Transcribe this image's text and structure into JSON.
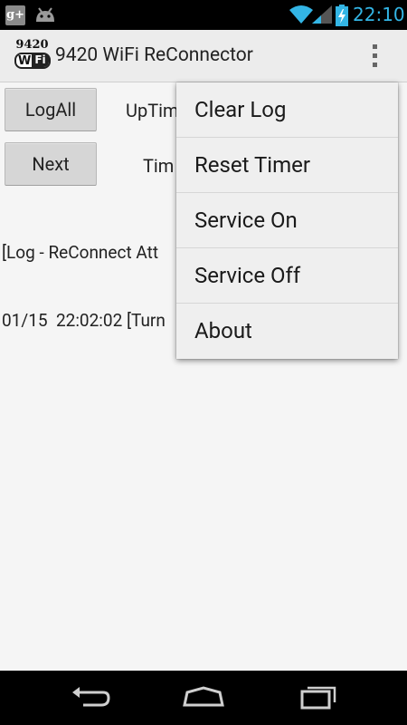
{
  "status_bar": {
    "time": "22:10",
    "left_icons": [
      "google-plus-icon",
      "android-icon"
    ],
    "right_icons": [
      "wifi-icon",
      "signal-icon",
      "battery-charging-icon"
    ],
    "gplus_label": "g+"
  },
  "action_bar": {
    "icon_number": "9420",
    "icon_wi": "Wi",
    "icon_fi": "Fi",
    "title": "9420 WiFi ReConnector"
  },
  "main": {
    "logall_button": "LogAll",
    "next_button": "Next",
    "uptime_label": "UpTim",
    "time_label": "Tim",
    "log_line1": "[Log - ReConnect Att",
    "log_line2": "01/15  22:02:02 [Turn"
  },
  "menu": {
    "items": [
      {
        "label": "Clear Log"
      },
      {
        "label": "Reset Timer"
      },
      {
        "label": "Service On"
      },
      {
        "label": "Service Off"
      },
      {
        "label": "About"
      }
    ]
  },
  "colors": {
    "accent": "#33b5e5",
    "action_bar_bg": "#ececec",
    "menu_bg": "#efefef",
    "content_bg": "#f5f5f5"
  }
}
